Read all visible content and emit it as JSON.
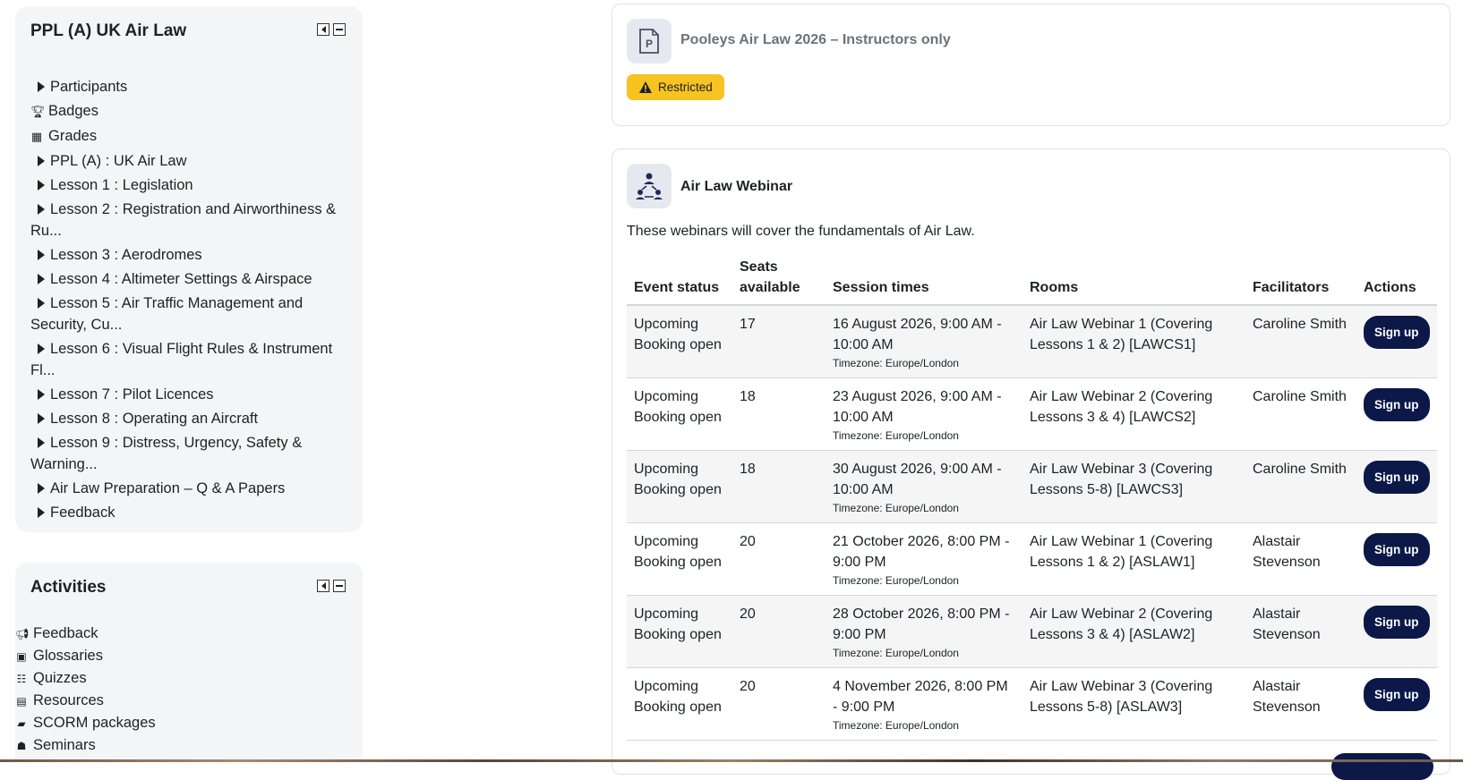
{
  "nav_block": {
    "title": "PPL (A) UK Air Law",
    "items": [
      {
        "label": "Participants",
        "icon": "arrow",
        "text": "Participants"
      },
      {
        "label": "Badges",
        "icon": "badge",
        "text": "Badges"
      },
      {
        "label": "Grades",
        "icon": "grades",
        "text": "Grades"
      },
      {
        "label": "PPL (A) : UK Air Law",
        "icon": "arrow"
      },
      {
        "label": "Lesson 1 : Legislation",
        "icon": "arrow"
      },
      {
        "label": "Lesson 2 : Registration and Airworthiness & Ru...",
        "icon": "arrow"
      },
      {
        "label": "Lesson 3 : Aerodromes",
        "icon": "arrow"
      },
      {
        "label": "Lesson 4 : Altimeter Settings & Airspace",
        "icon": "arrow"
      },
      {
        "label": "Lesson 5 : Air Traffic Management and Security, Cu...",
        "icon": "arrow"
      },
      {
        "label": "Lesson 6 : Visual Flight Rules & Instrument Fl...",
        "icon": "arrow"
      },
      {
        "label": "Lesson 7 : Pilot Licences",
        "icon": "arrow"
      },
      {
        "label": "Lesson 8 : Operating an Aircraft",
        "icon": "arrow"
      },
      {
        "label": "Lesson 9 : Distress, Urgency, Safety & Warning...",
        "icon": "arrow"
      },
      {
        "label": "Air Law Preparation – Q & A Papers",
        "icon": "arrow"
      },
      {
        "label": "Feedback",
        "icon": "arrow"
      }
    ]
  },
  "activities_block": {
    "title": "Activities",
    "items": [
      {
        "label": "Feedback",
        "icon": "megaphone"
      },
      {
        "label": "Glossaries",
        "icon": "glossary"
      },
      {
        "label": "Quizzes",
        "icon": "quiz"
      },
      {
        "label": "Resources",
        "icon": "file"
      },
      {
        "label": "SCORM packages",
        "icon": "package"
      },
      {
        "label": "Seminars",
        "icon": "seminar"
      }
    ]
  },
  "restricted_module": {
    "title": "Pooleys Air Law 2026 – Instructors only",
    "badge": "Restricted",
    "badge_color": "#f7c321"
  },
  "webinar": {
    "title": "Air Law Webinar",
    "description": "These webinars will cover the fundamentals of Air Law.",
    "headers": {
      "status": "Event status",
      "seats": "Seats available",
      "times": "Session times",
      "rooms": "Rooms",
      "facilitators": "Facilitators",
      "actions": "Actions"
    },
    "sessions": [
      {
        "status1": "Upcoming",
        "status2": "Booking open",
        "seats": "17",
        "time": "16 August 2026, 9:00 AM - 10:00 AM",
        "tz": "Timezone: Europe/London",
        "room": "Air Law Webinar 1 (Covering Lessons 1 & 2) [LAWCS1]",
        "facilitator": "Caroline Smith",
        "action": "Sign up"
      },
      {
        "status1": "Upcoming",
        "status2": "Booking open",
        "seats": "18",
        "time": "23 August 2026, 9:00 AM - 10:00 AM",
        "tz": "Timezone: Europe/London",
        "room": "Air Law Webinar 2 (Covering Lessons 3 & 4) [LAWCS2]",
        "facilitator": "Caroline Smith",
        "action": "Sign up"
      },
      {
        "status1": "Upcoming",
        "status2": "Booking open",
        "seats": "18",
        "time": "30 August 2026, 9:00 AM - 10:00 AM",
        "tz": "Timezone: Europe/London",
        "room": "Air Law Webinar 3 (Covering Lessons 5-8) [LAWCS3]",
        "facilitator": "Caroline Smith",
        "action": "Sign up"
      },
      {
        "status1": "Upcoming",
        "status2": "Booking open",
        "seats": "20",
        "time": "21 October 2026, 8:00 PM - 9:00 PM",
        "tz": "Timezone: Europe/London",
        "room": "Air Law Webinar 1 (Covering Lessons 1 & 2) [ASLAW1]",
        "facilitator": "Alastair Stevenson",
        "action": "Sign up"
      },
      {
        "status1": "Upcoming",
        "status2": "Booking open",
        "seats": "20",
        "time": "28 October 2026, 8:00 PM - 9:00 PM",
        "tz": "Timezone: Europe/London",
        "room": "Air Law Webinar 2 (Covering Lessons 3 & 4) [ASLAW2]",
        "facilitator": "Alastair Stevenson",
        "action": "Sign up"
      },
      {
        "status1": "Upcoming",
        "status2": "Booking open",
        "seats": "20",
        "time": "4 November 2026, 8:00 PM - 9:00 PM",
        "tz": "Timezone: Europe/London",
        "room": "Air Law Webinar 3 (Covering Lessons 5-8) [ASLAW3]",
        "facilitator": "Alastair Stevenson",
        "action": "Sign up"
      }
    ]
  }
}
